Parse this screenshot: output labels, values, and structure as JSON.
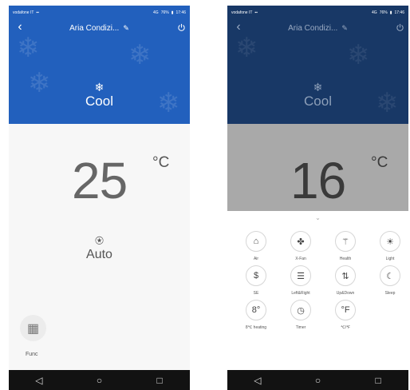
{
  "status_bar": {
    "carrier": "vodafone IT",
    "signal": "4G",
    "battery": "76%",
    "time": "17:46"
  },
  "left_screen": {
    "title": "Aria Condizi...",
    "mode_label": "Cool",
    "temperature": "25",
    "unit": "°C",
    "fan_label": "Auto",
    "func_label": "Func"
  },
  "right_screen": {
    "title": "Aria Condizi...",
    "mode_label": "Cool",
    "temperature": "16",
    "unit": "°C",
    "functions": [
      {
        "label": "Air",
        "icon": "air-icon",
        "glyph": "⌂"
      },
      {
        "label": "X-Fan",
        "icon": "fan-icon",
        "glyph": "✤"
      },
      {
        "label": "Health",
        "icon": "health-icon",
        "glyph": "⚚"
      },
      {
        "label": "Light",
        "icon": "light-icon",
        "glyph": "☀"
      },
      {
        "label": "SE",
        "icon": "se-icon",
        "glyph": "$"
      },
      {
        "label": "Left&Right",
        "icon": "left-right-swing-icon",
        "glyph": "☰"
      },
      {
        "label": "Up&Down",
        "icon": "up-down-swing-icon",
        "glyph": "⇅"
      },
      {
        "label": "Sleep",
        "icon": "sleep-icon",
        "glyph": "☾"
      },
      {
        "label": "8℃ heating",
        "icon": "heating-icon",
        "glyph": "8°"
      },
      {
        "label": "Timer",
        "icon": "timer-icon",
        "glyph": "◷"
      },
      {
        "label": "℃/℉",
        "icon": "temperature-unit-icon",
        "glyph": "°F"
      }
    ]
  },
  "icons": {
    "back": "chevron-left-icon",
    "edit": "pencil-icon",
    "power": "power-icon",
    "mode": "snowflake-icon",
    "fan": "fan-icon",
    "func": "grid-icon",
    "nav_back": "nav-back-icon",
    "nav_home": "nav-home-icon",
    "nav_recent": "nav-recent-icon"
  },
  "colors": {
    "header_blue": "#2260bd",
    "header_dim": "#183866",
    "overlay_gray": "#a9a9a9"
  }
}
